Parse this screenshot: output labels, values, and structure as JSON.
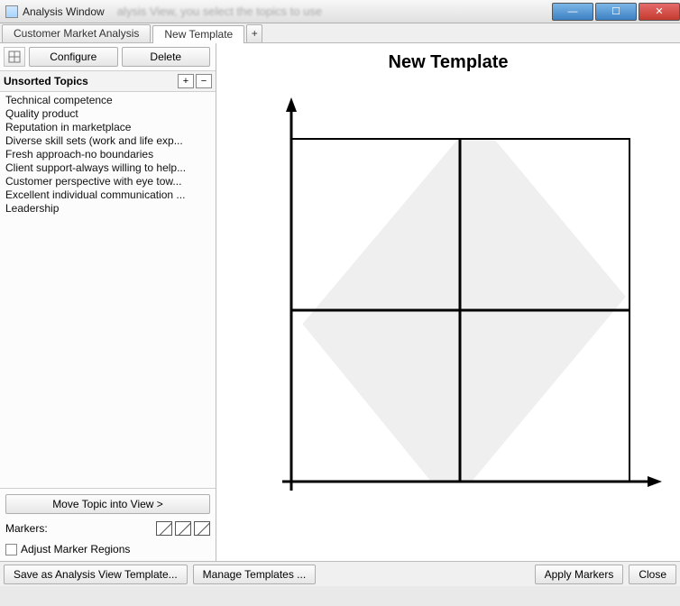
{
  "window": {
    "title": "Analysis Window",
    "blur_text": "alysis View, you select the topics to use"
  },
  "tabs": {
    "items": [
      {
        "label": "Customer Market Analysis",
        "active": false
      },
      {
        "label": "New Template",
        "active": true
      }
    ],
    "add": "+"
  },
  "toolbar": {
    "configure": "Configure",
    "delete": "Delete"
  },
  "unsorted": {
    "header": "Unsorted Topics",
    "plus": "+",
    "minus": "−",
    "items": [
      " Technical competence",
      "Quality product",
      "Reputation in marketplace",
      "Diverse skill sets (work and life exp...",
      "Fresh approach-no boundaries",
      "Client support-always willing to help...",
      "Customer perspective with eye tow...",
      "Excellent individual communication ...",
      "Leadership"
    ]
  },
  "sidebar_bottom": {
    "move": "Move Topic into View >",
    "markers_label": "Markers:",
    "adjust": "Adjust Marker Regions"
  },
  "canvas": {
    "title": "New Template"
  },
  "bottombar": {
    "save": "Save as Analysis View Template...",
    "manage": "Manage Templates ...",
    "apply": "Apply Markers",
    "close": "Close"
  },
  "chart_data": {
    "type": "scatter",
    "title": "New Template",
    "xlabel": "",
    "ylabel": "",
    "xlim": [
      0,
      1
    ],
    "ylim": [
      0,
      1
    ],
    "quadrants": true,
    "series": []
  }
}
